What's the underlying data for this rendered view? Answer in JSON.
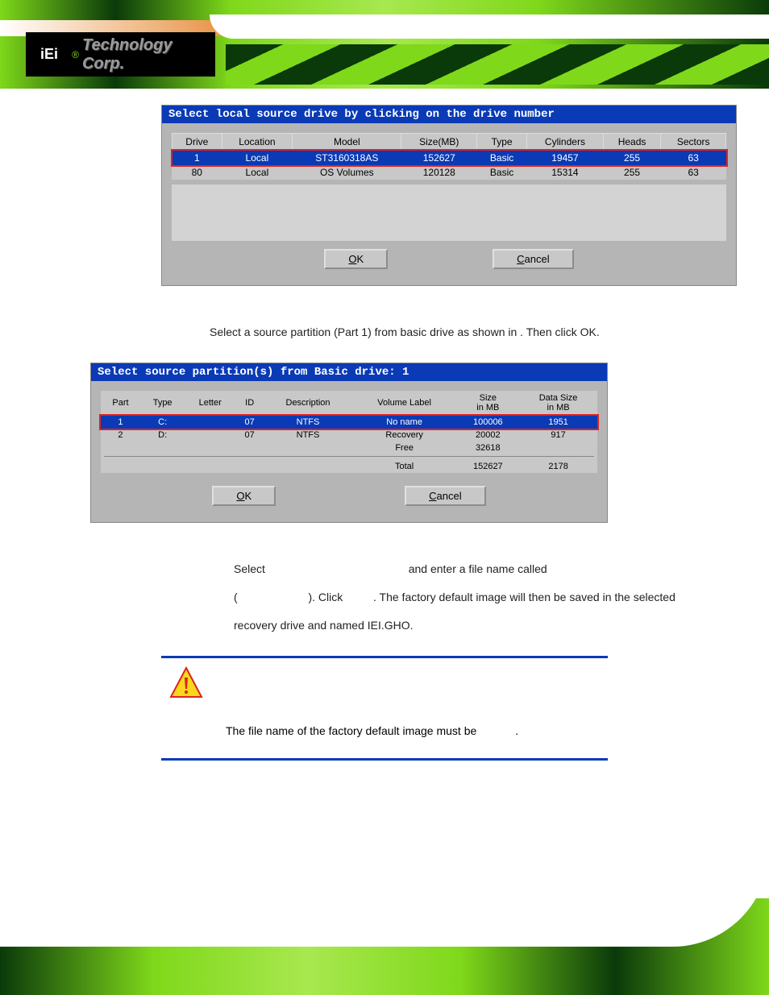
{
  "header": {
    "logo_text": "Technology Corp.",
    "logo_prefix": "®"
  },
  "dialog1": {
    "title": "Select local source drive by clicking on the drive number",
    "headers": [
      "Drive",
      "Location",
      "Model",
      "Size(MB)",
      "Type",
      "Cylinders",
      "Heads",
      "Sectors"
    ],
    "rows": [
      {
        "selected": true,
        "cells": [
          "1",
          "Local",
          "ST3160318AS",
          "152627",
          "Basic",
          "19457",
          "255",
          "63"
        ]
      },
      {
        "selected": false,
        "cells": [
          "80",
          "Local",
          "OS Volumes",
          "120128",
          "Basic",
          "15314",
          "255",
          "63"
        ]
      }
    ],
    "ok": "OK",
    "cancel": "Cancel"
  },
  "step4_text": "Select a source partition (Part 1) from basic drive as shown in             . Then click OK.",
  "dialog2": {
    "title": "Select source partition(s) from Basic drive: 1",
    "headers": [
      "Part",
      "Type",
      "Letter",
      "ID",
      "Description",
      "Volume Label",
      "Size in MB",
      "Data Size in MB"
    ],
    "rows": [
      {
        "selected": true,
        "cells": [
          "1",
          "C:",
          "",
          "07",
          "NTFS",
          "No name",
          "100006",
          "1951"
        ]
      },
      {
        "selected": false,
        "cells": [
          "2",
          "D:",
          "",
          "07",
          "NTFS",
          "Recovery",
          "20002",
          "917"
        ]
      }
    ],
    "free_label": "Free",
    "free_size": "32618",
    "total_label": "Total",
    "total_size": "152627",
    "total_data": "2178",
    "ok": "OK",
    "cancel": "Cancel"
  },
  "step10_text_1": "Select",
  "step10_text_2": "and enter a file name called",
  "step10_text_3": "(",
  "step10_text_4": "). Click",
  "step10_text_5": ". The factory default image will then be saved in the selected recovery drive and named IEI.GHO.",
  "warning_text_1": "The file name of the factory default image must be",
  "warning_text_2": "."
}
